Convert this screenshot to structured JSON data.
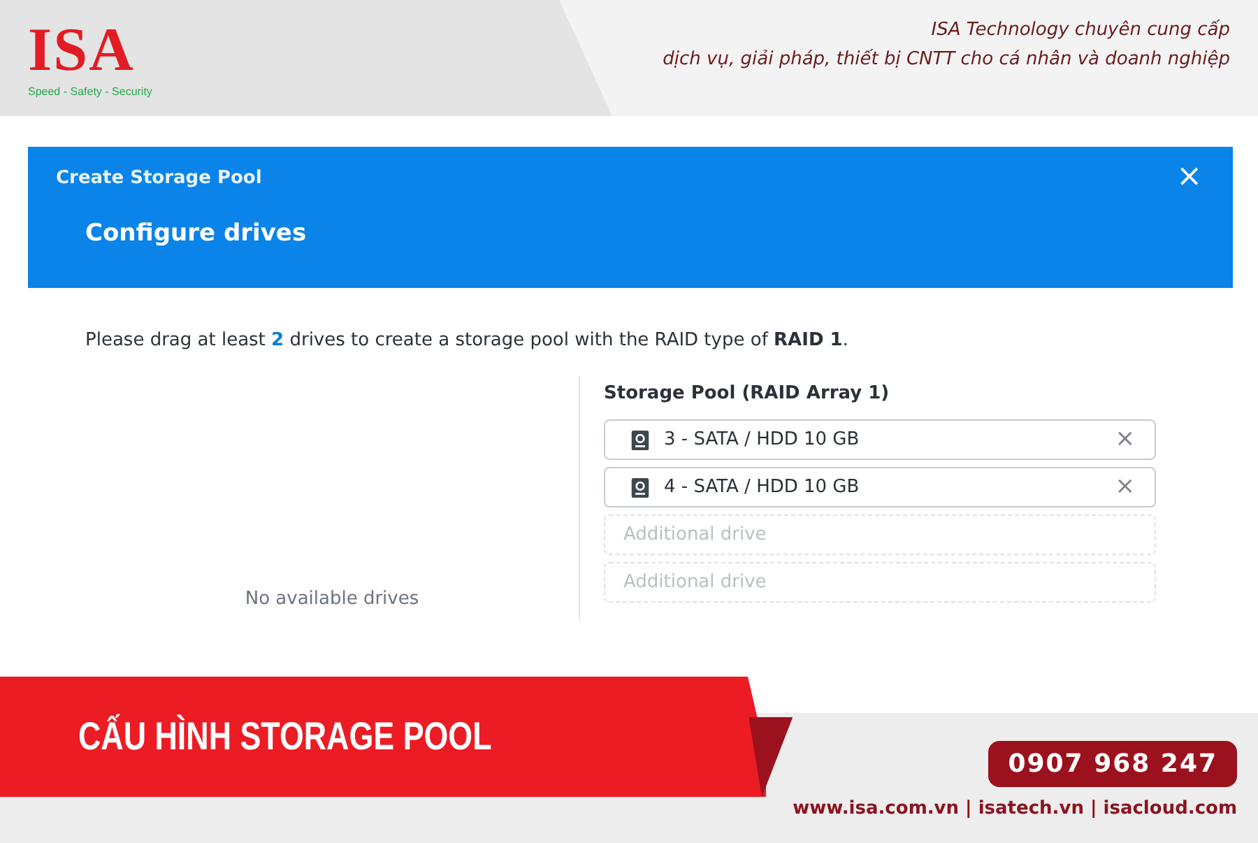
{
  "brand": {
    "logo": "ISA",
    "tagline": "Speed - Safety - Security",
    "slogan": [
      "ISA Technology chuyên cung cấp",
      "dịch vụ, giải pháp, thiết bị CNTT cho cá nhân và doanh nghiệp"
    ]
  },
  "dialog": {
    "title": "Create Storage Pool",
    "close": "×",
    "step": "Configure drives",
    "instruction": "Please drag at least **2** drives to create a storage pool with the RAID type of **RAID 1**.",
    "available": {
      "empty_text": "No available drives"
    },
    "pool": {
      "title": "Storage Pool (RAID Array 1)",
      "slots": [
        {
          "kind": "drive",
          "label": "3 - SATA / HDD 10 GB",
          "remove": "×"
        },
        {
          "kind": "drive",
          "label": "4 - SATA / HDD 10 GB",
          "remove": "×"
        },
        {
          "kind": "empty",
          "label": "Additional drive"
        },
        {
          "kind": "empty",
          "label": "Additional drive"
        }
      ]
    }
  },
  "footer": {
    "headline": "CẤU HÌNH STORAGE POOL",
    "phone": "0907 968 247",
    "links": "www.isa.com.vn | isatech.vn | isacloud.com"
  }
}
